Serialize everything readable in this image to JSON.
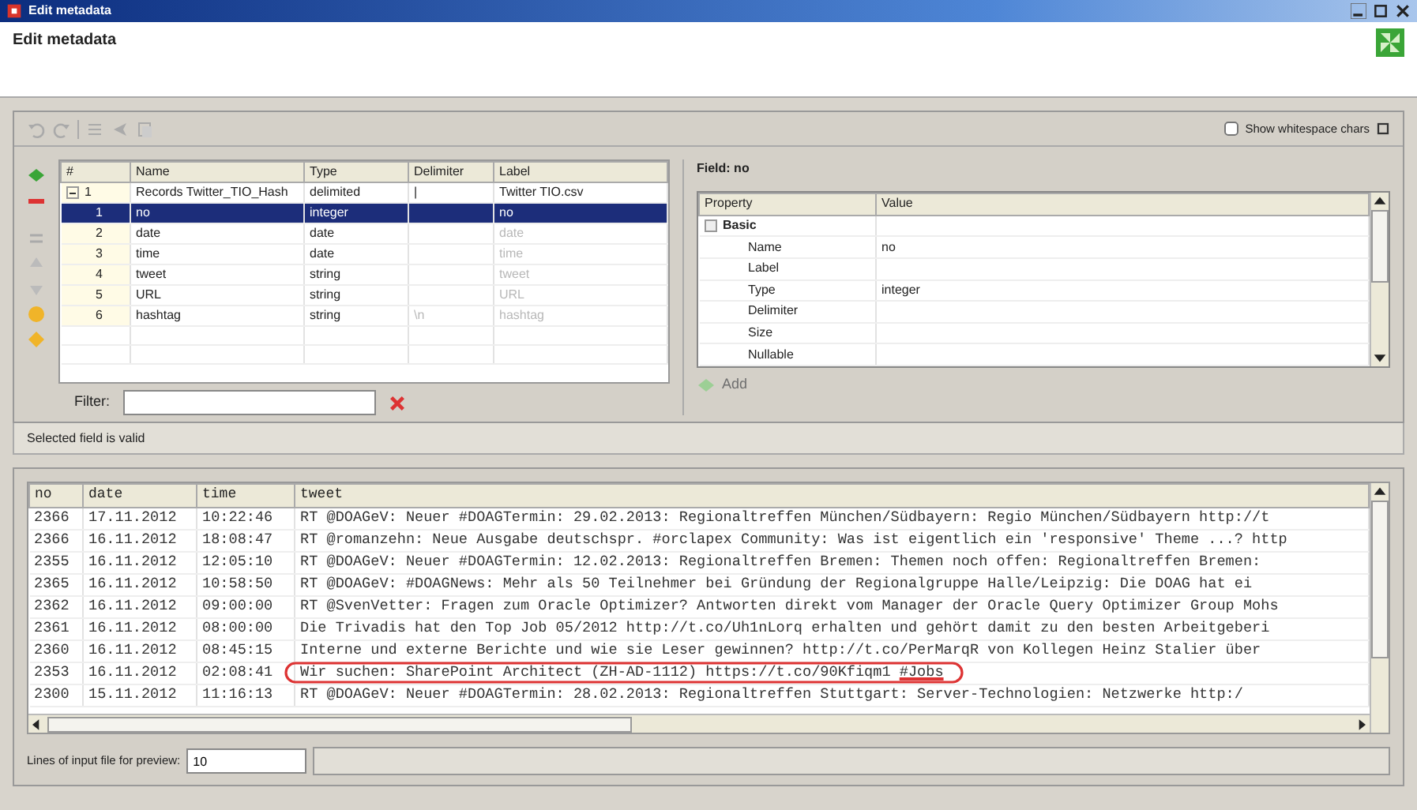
{
  "window": {
    "title": "Edit metadata"
  },
  "header": {
    "title": "Edit metadata"
  },
  "toolbar": {
    "show_whitespace": {
      "label": "Show whitespace chars",
      "checked": false
    }
  },
  "fields_table": {
    "columns": [
      "#",
      "Name",
      "Type",
      "Delimiter",
      "Label"
    ],
    "rows": [
      {
        "num": "1",
        "name": "Records Twitter_TIO_Hash",
        "type": "delimited",
        "delimiter": "|",
        "label": "Twitter TIO.csv",
        "kind": "record",
        "expanded": true,
        "selected": false
      },
      {
        "num": "1",
        "name": "no",
        "type": "integer",
        "delimiter": "",
        "label": "no",
        "kind": "field",
        "selected": true
      },
      {
        "num": "2",
        "name": "date",
        "type": "date",
        "delimiter": "",
        "label": "date",
        "kind": "field",
        "selected": false
      },
      {
        "num": "3",
        "name": "time",
        "type": "date",
        "delimiter": "",
        "label": "time",
        "kind": "field",
        "selected": false
      },
      {
        "num": "4",
        "name": "tweet",
        "type": "string",
        "delimiter": "",
        "label": "tweet",
        "kind": "field",
        "selected": false
      },
      {
        "num": "5",
        "name": "URL",
        "type": "string",
        "delimiter": "",
        "label": "URL",
        "kind": "field",
        "selected": false
      },
      {
        "num": "6",
        "name": "hashtag",
        "type": "string",
        "delimiter": "\\n",
        "label": "hashtag",
        "kind": "field",
        "selected": false
      }
    ]
  },
  "filter": {
    "label": "Filter:"
  },
  "property_panel": {
    "title": "Field: no",
    "columns": [
      "Property",
      "Value"
    ],
    "rows": [
      {
        "property": "Basic",
        "value": "",
        "kind": "group",
        "expanded": true
      },
      {
        "property": "Name",
        "value": "no",
        "kind": "item"
      },
      {
        "property": "Label",
        "value": "",
        "kind": "item"
      },
      {
        "property": "Type",
        "value": "integer",
        "kind": "item"
      },
      {
        "property": "Delimiter",
        "value": "",
        "kind": "item"
      },
      {
        "property": "Size",
        "value": "",
        "kind": "item"
      },
      {
        "property": "Nullable",
        "value": "",
        "kind": "item"
      }
    ],
    "add_label": "Add"
  },
  "status": "Selected field is valid",
  "preview": {
    "columns": [
      "no",
      "date",
      "time",
      "tweet"
    ],
    "rows": [
      [
        "2366",
        "17.11.2012",
        "10:22:46",
        "RT @DOAGeV:  Neuer #DOAGTermin: 29.02.2013: Regionaltreffen München/Südbayern: Regio München/Südbayern http://t"
      ],
      [
        "2366",
        "16.11.2012",
        "18:08:47",
        "RT @romanzehn: Neue Ausgabe deutschspr. #orclapex Community: Was ist eigentlich ein 'responsive' Theme ...? http"
      ],
      [
        "2355",
        "16.11.2012",
        "12:05:10",
        "RT @DOAGeV:  Neuer #DOAGTermin: 12.02.2013: Regionaltreffen Bremen: Themen noch offen: Regionaltreffen Bremen:"
      ],
      [
        "2365",
        "16.11.2012",
        "10:58:50",
        "RT @DOAGeV:  #DOAGNews:  Mehr als 50 Teilnehmer bei Gründung der Regionalgruppe Halle/Leipzig: Die DOAG hat ei"
      ],
      [
        "2362",
        "16.11.2012",
        "09:00:00",
        "RT @SvenVetter: Fragen zum Oracle Optimizer? Antworten direkt vom Manager der Oracle Query Optimizer Group Mohs"
      ],
      [
        "2361",
        "16.11.2012",
        "08:00:00",
        "Die Trivadis hat den Top Job 05/2012 http://t.co/Uh1nLorq erhalten und gehört damit zu den besten Arbeitgeberi"
      ],
      [
        "2360",
        "16.11.2012",
        "08:45:15",
        "Interne und externe Berichte und wie sie Leser gewinnen? http://t.co/PerMarqR von Kollegen Heinz Stalier über"
      ],
      [
        "2353",
        "16.11.2012",
        "02:08:41",
        "Wir suchen: SharePoint Architect (ZH-AD-1112) https://t.co/90Kfiqm1 #Jobs"
      ],
      [
        "2300",
        "15.11.2012",
        "11:16:13",
        "RT @DOAGeV:  Neuer #DOAGTermin: 28.02.2013: Regionaltreffen Stuttgart: Server-Technologien: Netzwerke http:/"
      ]
    ],
    "circled": [
      false,
      false,
      false,
      false,
      false,
      false,
      false,
      true,
      false
    ]
  },
  "preview_lines": {
    "label": "Lines of input file for preview:",
    "value": "10"
  }
}
